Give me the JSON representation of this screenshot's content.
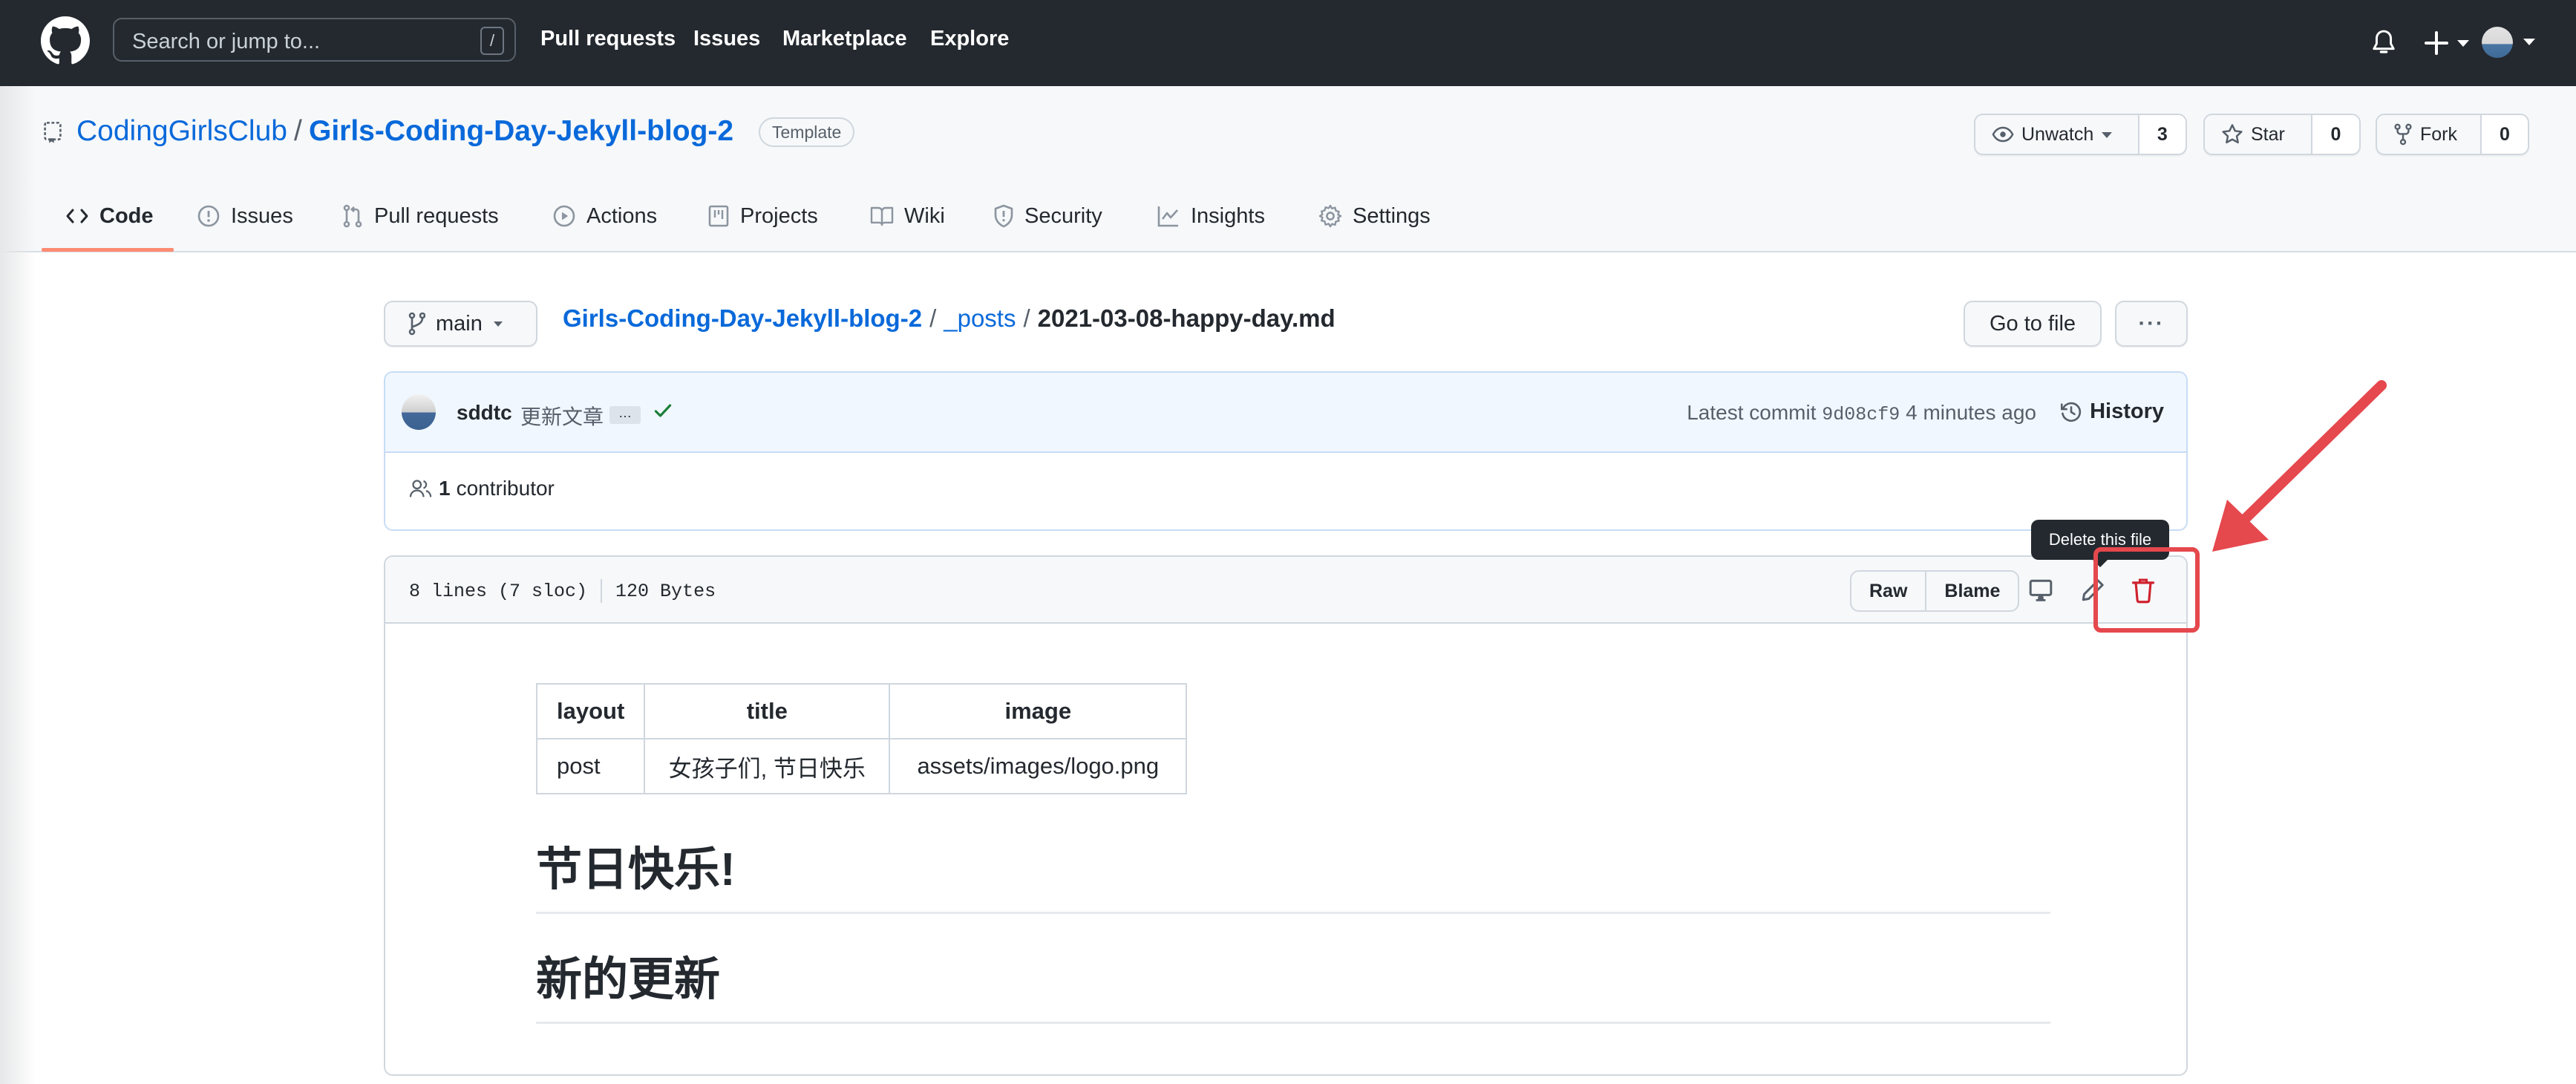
{
  "header": {
    "search_placeholder": "Search or jump to...",
    "search_shortcut": "/",
    "nav": [
      "Pull requests",
      "Issues",
      "Marketplace",
      "Explore"
    ],
    "icons": [
      "github-logo-icon",
      "bell-icon",
      "plus-icon",
      "avatar"
    ]
  },
  "repo": {
    "owner": "CodingGirlsClub",
    "separator": "/",
    "name": "Girls-Coding-Day-Jekyll-blog-2",
    "badge": "Template",
    "watch": {
      "label": "Unwatch",
      "count": "3"
    },
    "star": {
      "label": "Star",
      "count": "0"
    },
    "fork": {
      "label": "Fork",
      "count": "0"
    },
    "tabs": [
      {
        "label": "Code",
        "icon": "code-icon",
        "active": true
      },
      {
        "label": "Issues",
        "icon": "issue-icon"
      },
      {
        "label": "Pull requests",
        "icon": "pull-request-icon"
      },
      {
        "label": "Actions",
        "icon": "play-icon"
      },
      {
        "label": "Projects",
        "icon": "project-icon"
      },
      {
        "label": "Wiki",
        "icon": "book-icon"
      },
      {
        "label": "Security",
        "icon": "shield-icon"
      },
      {
        "label": "Insights",
        "icon": "graph-icon"
      },
      {
        "label": "Settings",
        "icon": "gear-icon"
      }
    ]
  },
  "file_nav": {
    "branch": "main",
    "breadcrumb": {
      "repo": "Girls-Coding-Day-Jekyll-blog-2",
      "sep": "/",
      "folder": "_posts",
      "file": "2021-03-08-happy-day.md"
    },
    "go_to_file": "Go to file",
    "more": "···"
  },
  "commit": {
    "author": "sddtc",
    "message": "更新文章",
    "ellipsis": "…",
    "latest_label": "Latest commit",
    "sha": "9d08cf9",
    "time": "4 minutes ago",
    "history": "History",
    "contributors_count": "1",
    "contributors_label": "contributor"
  },
  "file": {
    "lines": "8 lines (7 sloc)",
    "size": "120 Bytes",
    "raw": "Raw",
    "blame": "Blame",
    "delete_tooltip": "Delete this file",
    "table": {
      "headers": [
        "layout",
        "title",
        "image"
      ],
      "rows": [
        [
          "post",
          "女孩子们, 节日快乐",
          "assets/images/logo.png"
        ]
      ]
    },
    "h1": "节日快乐!",
    "h2": "新的更新"
  },
  "colors": {
    "header_bg": "#24292f",
    "link": "#0969da",
    "tab_underline": "#fd8c73",
    "annotation_red": "#e5484d",
    "delete_red": "#cf222e",
    "check_green": "#1a7f37"
  }
}
